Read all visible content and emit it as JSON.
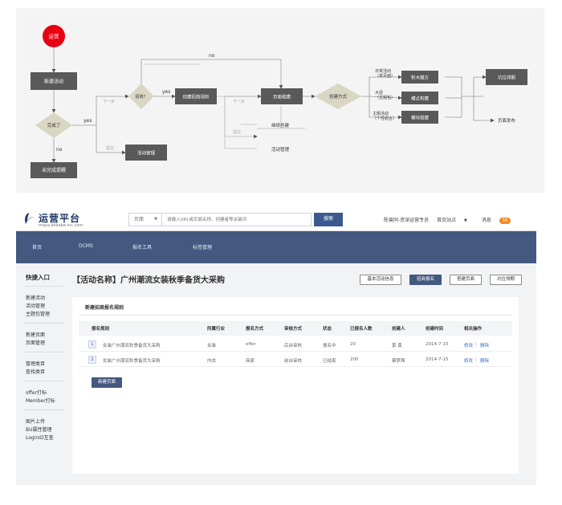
{
  "flowchart": {
    "start": "运营",
    "new_activity": "新建活动",
    "finished": "完成了",
    "unfinished_reminder": "未完成提醒",
    "yes": "yes",
    "no": "no",
    "step_next": "下一步",
    "step_submit": "提交",
    "merchant_q": "招商？",
    "create_rule": "创建招商规则",
    "activity_mgmt": "活动管理",
    "page_build": "页面搭建",
    "continue_create": "继续创建",
    "create_method": "创建方式",
    "daily_label": "日常活动\n（单页面）",
    "promo_label": "大促\n（主题包）",
    "theme_label": "主题活动\n（个性组合）",
    "block_cube": "积木魔方",
    "slot_build": "槽点构建",
    "module_build": "模块搭建",
    "position_sort": "坑位排期",
    "page_publish": "页面发布"
  },
  "app": {
    "logo_title": "运营平台",
    "logo_sub": "maya.alibaba-inc.com",
    "search_type": "页面",
    "search_placeholder": "请输入URL或页面名称、创建者等关键词",
    "search_button": "搜索",
    "user_name": "陈竟同-资深运营专员",
    "site_label": "首页站点",
    "messages_label": "消息",
    "messages_count": "58",
    "nav": [
      "首页",
      "DCMS",
      "报名工具",
      "标签管理"
    ],
    "sidebar": {
      "heading": "快捷入口",
      "group1": [
        "新建活动",
        "活动管理",
        "主题包管理"
      ],
      "group2": [
        "新建页面",
        "页面管理"
      ],
      "group3": [
        "管理类目",
        "查找类目"
      ],
      "group4": [
        "offer打标",
        "Member打标"
      ],
      "group5": [
        "图片上传",
        "BU属性管理",
        "LoginID互查"
      ]
    },
    "page_title": "【活动名称】广州潮流女装秋季备货大采购",
    "actions": [
      "基本活动信息",
      "招商报名",
      "搭建页面",
      "坑位排期"
    ],
    "card_title": "新建招商报名规则",
    "columns": [
      "报名规则",
      "所属行业",
      "报名方式",
      "审核方式",
      "状态",
      "已报名人数",
      "创建人",
      "创建时间",
      "相关操作"
    ],
    "rows": [
      {
        "no": "1",
        "rule": "女装广州潮流秋季备货大采购",
        "industry": "女装",
        "method": "offer",
        "review": "后台审核",
        "status": "报名中",
        "count": "20",
        "creator": "黄 黄",
        "time": "2014-7-15",
        "edit": "修改",
        "delete": "删除"
      },
      {
        "no": "2",
        "rule": "女装广州潮流秋季备货大采购",
        "industry": "内衣",
        "method": "商家",
        "review": "前台审核",
        "status": "已结束",
        "count": "200",
        "creator": "蔡梦茜",
        "time": "2014-7-15",
        "edit": "修改",
        "delete": "删除"
      }
    ],
    "new_page_button": "新建页面"
  },
  "colors": {
    "accent": "#44597f",
    "start_circle": "#e60012",
    "box_dark": "#595959",
    "diamond": "#d9d6c3"
  }
}
